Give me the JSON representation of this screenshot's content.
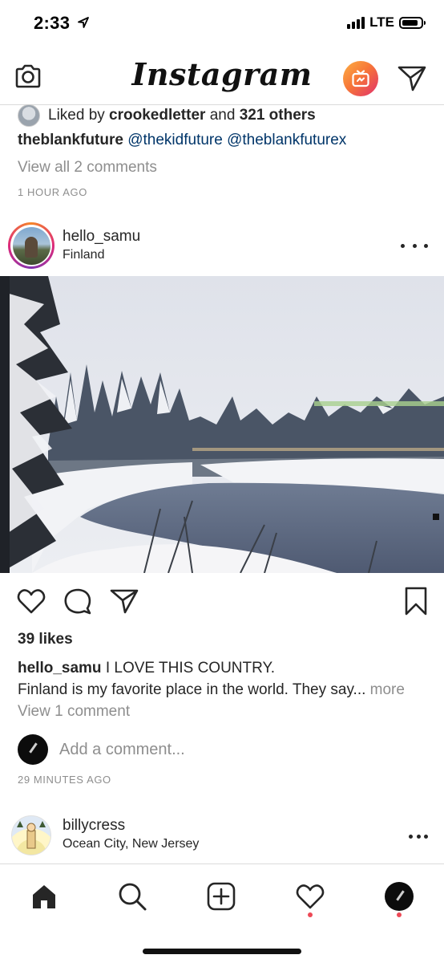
{
  "status_bar": {
    "time": "2:33",
    "network": "LTE",
    "signal_bars": 4,
    "battery_level": 0.85,
    "location_icon": "location-arrow-icon"
  },
  "header": {
    "logo": "Instagram",
    "camera_icon": "camera-icon",
    "igtv_icon": "igtv-icon",
    "direct_icon": "direct-message-icon"
  },
  "previous_post": {
    "liked_prefix": "Liked by ",
    "liked_user": "crookedletter",
    "liked_and": " and ",
    "liked_others": "321 others",
    "caption_user": "theblankfuture",
    "caption_tags": [
      "@thekidfuture",
      "@theblankfuturex"
    ],
    "view_comments": "View all 2 comments",
    "time_ago": "1 HOUR AGO"
  },
  "post": {
    "username": "hello_samu",
    "location": "Finland",
    "likes": "39 likes",
    "caption_user": "hello_samu",
    "caption_first": " I LOVE THIS COUNTRY.",
    "caption_second": "Finland is my favorite place in the world. They say... ",
    "caption_more": "more",
    "view_comments": "View 1 comment",
    "add_comment_placeholder": "Add a comment...",
    "time_ago": "29 MINUTES AGO"
  },
  "next_post": {
    "username": "billycress",
    "location": "Ocean City, New Jersey"
  },
  "tab_bar": {
    "items": [
      "home-icon",
      "search-icon",
      "new-post-icon",
      "activity-heart-icon",
      "profile-avatar"
    ],
    "activity_notification": true,
    "profile_notification": true
  },
  "colors": {
    "text": "#262626",
    "muted": "#8e8e8e",
    "link": "#003569",
    "divider": "#dbdbdb",
    "notification": "#ed4956"
  }
}
